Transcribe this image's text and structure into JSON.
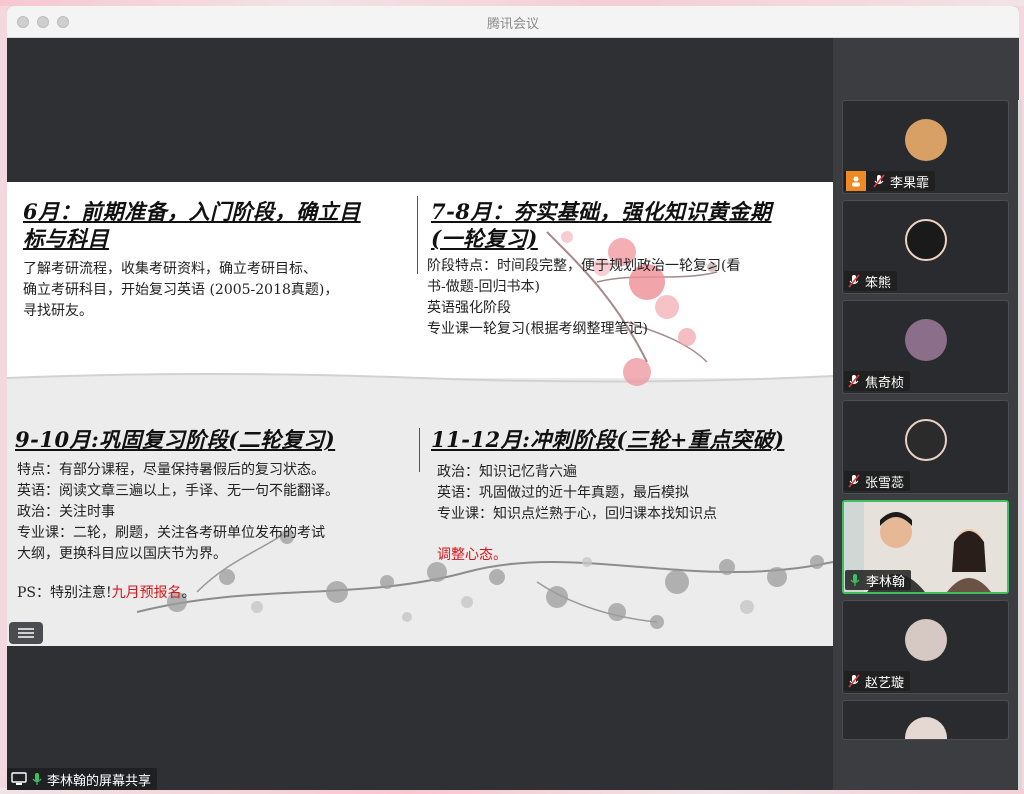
{
  "window": {
    "title": "腾讯会议"
  },
  "slide": {
    "q1": {
      "heading_line1": "6月：前期准备，入门阶段，确立目",
      "heading_line2": "标与科目",
      "lines": [
        "了解考研流程，收集考研资料，确立考研目标、",
        "确立考研科目，开始复习英语 (2005-2018真题)，",
        "寻找研友。"
      ]
    },
    "q2": {
      "heading_line1": "7-8月：夯实基础，强化知识黄金期",
      "heading_line2": "(一轮复习)",
      "lines": [
        "阶段特点：时间段完整，便于规划政治一轮复习(看",
        "书-做题-回归书本)",
        "英语强化阶段",
        "专业课一轮复习(根据考纲整理笔记)"
      ]
    },
    "q3": {
      "heading": "9-10月:巩固复习阶段(二轮复习)",
      "lines": [
        "特点：有部分课程，尽量保持暑假后的复习状态。",
        "英语：阅读文章三遍以上，手译、无一句不能翻译。",
        "政治：关注时事",
        "专业课：二轮，刷题，关注各考研单位发布的考试",
        "大纲，更换科目应以国庆节为界。"
      ],
      "ps_prefix": "PS：特别注意!",
      "ps_highlight": "九月预报名",
      "ps_suffix": "。"
    },
    "q4": {
      "heading": "11-12月:冲刺阶段(三轮+重点突破)",
      "lines": [
        "政治：知识记忆背六遍",
        "英语：巩固做过的近十年真题，最后模拟",
        "专业课：知识点烂熟于心，回归课本找知识点"
      ],
      "highlight": "调整心态。"
    }
  },
  "share_label": "李林翰的屏幕共享",
  "participants": [
    {
      "name": "李果霏",
      "host": true,
      "mic": "off",
      "avatar_color": "#d9a066"
    },
    {
      "name": "笨熊",
      "host": false,
      "mic": "off",
      "avatar_color": "#1a1a1a"
    },
    {
      "name": "焦奇桢",
      "host": false,
      "mic": "off",
      "avatar_color": "#8b6f8a"
    },
    {
      "name": "张雪蕊",
      "host": false,
      "mic": "off",
      "avatar_color": "#2b2b2b"
    },
    {
      "name": "李林翰",
      "host": false,
      "mic": "on",
      "avatar_color": "#e8e4df"
    },
    {
      "name": "赵艺璇",
      "host": false,
      "mic": "off",
      "avatar_color": "#d6c9c4"
    }
  ],
  "colors": {
    "accent_green": "#3ec05f",
    "host_orange": "#f08a24",
    "highlight_red": "#d7161b"
  }
}
